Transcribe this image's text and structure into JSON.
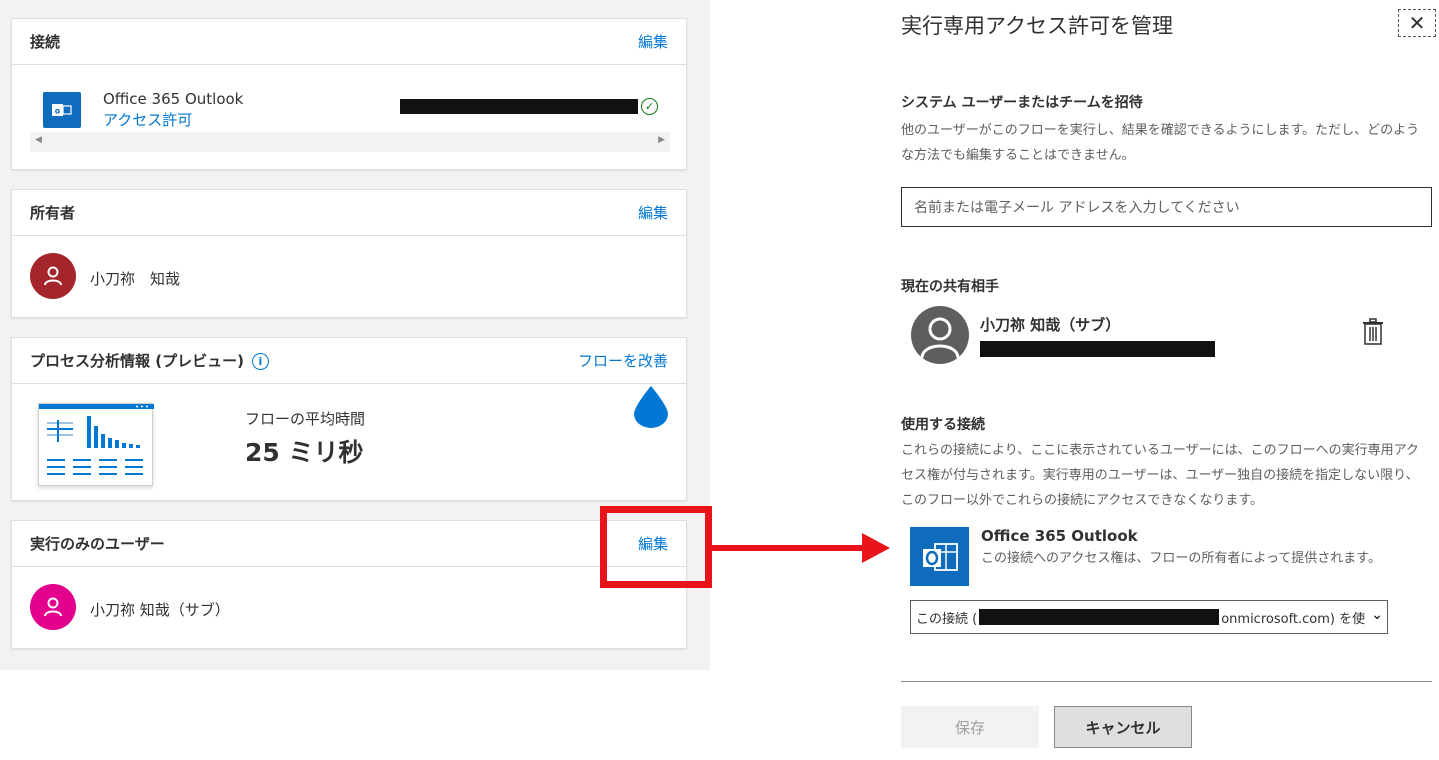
{
  "connections_card": {
    "title": "接続",
    "edit_label": "編集",
    "item": {
      "icon": "outlook-icon",
      "name": "Office 365 Outlook",
      "permission_link": "アクセス許可"
    }
  },
  "owners_card": {
    "title": "所有者",
    "edit_label": "編集",
    "owner": {
      "name": "小刀祢　知哉",
      "avatar_color": "#a4262c"
    }
  },
  "process_card": {
    "title": "プロセス分析情報 (プレビュー)",
    "improve_link": "フローを改善",
    "avg_label": "フローの平均時間",
    "avg_value": "25 ミリ秒",
    "drop_color": "#0078d4"
  },
  "run_only_card": {
    "title": "実行のみのユーザー",
    "edit_label": "編集",
    "user": {
      "name": "小刀祢 知哉（サブ）",
      "avatar_color": "#e3008c"
    }
  },
  "dialog": {
    "title": "実行専用アクセス許可を管理",
    "invite_heading": "システム ユーザーまたはチームを招待",
    "invite_desc": "他のユーザーがこのフローを実行し、結果を確認できるようにします。ただし、どのような方法でも編集することはできません。",
    "input_placeholder": "名前または電子メール アドレスを入力してください",
    "shared_heading": "現在の共有相手",
    "shared_user": "小刀祢 知哉（サブ）",
    "connections_heading": "使用する接続",
    "connections_desc": "これらの接続により、ここに表示されているユーザーには、このフローへの実行専用アクセス権が付与されます。実行専用のユーザーは、ユーザー独自の接続を指定しない限り、このフロー以外でこれらの接続にアクセスできなくなります。",
    "connection_name": "Office 365 Outlook",
    "connection_desc": "この接続へのアクセス権は、フローの所有者によって提供されます。",
    "select_prefix": "この接続 (",
    "select_suffix": "onmicrosoft.com) を使",
    "save_label": "保存",
    "cancel_label": "キャンセル"
  },
  "colors": {
    "accent": "#0078d4",
    "highlight": "#e8141a"
  }
}
